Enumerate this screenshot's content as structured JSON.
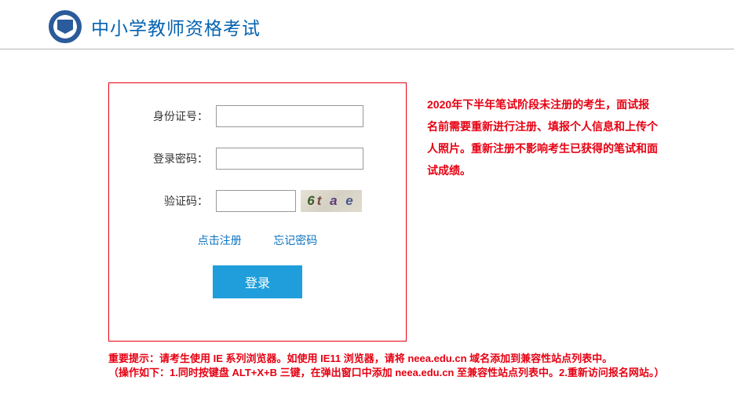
{
  "header": {
    "title": "中小学教师资格考试"
  },
  "form": {
    "id_label": "身份证号：",
    "id_value": "",
    "pwd_label": "登录密码：",
    "pwd_value": "",
    "captcha_label": "验证码：",
    "captcha_value": "",
    "captcha_text": "6tae"
  },
  "links": {
    "register": "点击注册",
    "forgot": "忘记密码"
  },
  "login_btn": "登录",
  "notice": "2020年下半年笔试阶段未注册的考生，面试报名前需要重新进行注册、填报个人信息和上传个人照片。重新注册不影响考生已获得的笔试和面试成绩。",
  "footer": {
    "line1": "重要提示：请考生使用 IE 系列浏览器。如使用 IE11 浏览器，请将 neea.edu.cn 域名添加到兼容性站点列表中。",
    "line2": "（操作如下：1.同时按键盘 ALT+X+B 三键，在弹出窗口中添加 neea.edu.cn 至兼容性站点列表中。2.重新访问报名网站。）"
  }
}
